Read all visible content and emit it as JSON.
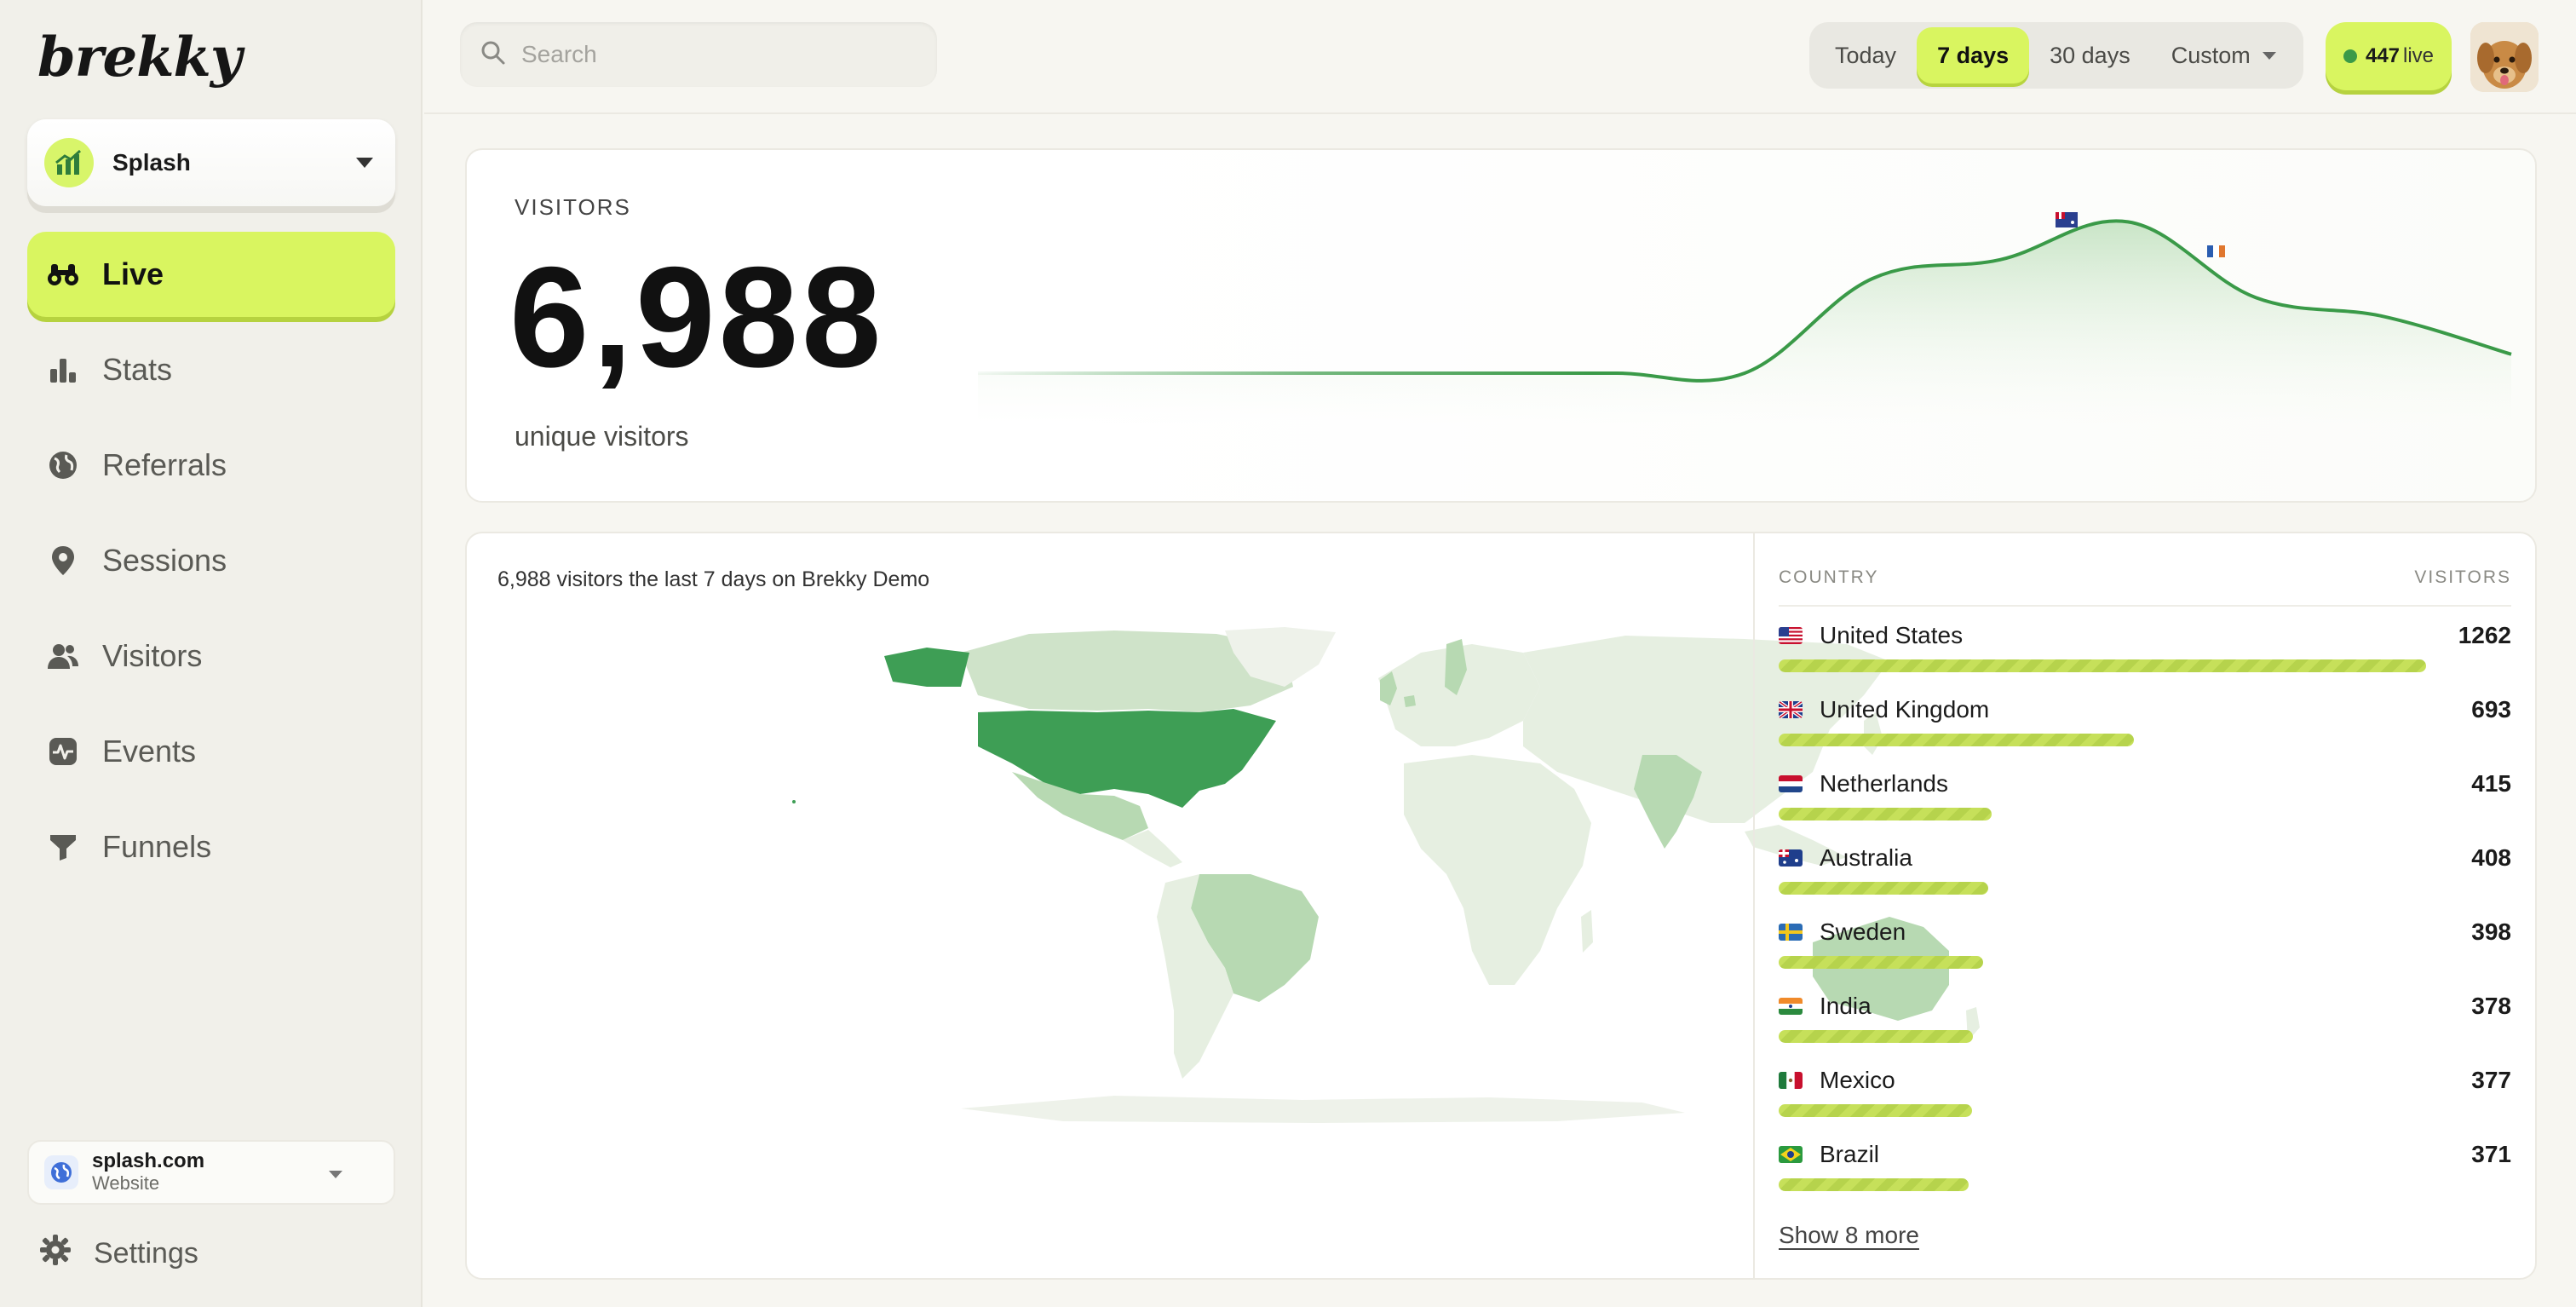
{
  "app": {
    "logo_text": "brekky"
  },
  "site_switcher": {
    "name": "Splash"
  },
  "nav": {
    "items": [
      {
        "label": "Live",
        "icon": "binoculars-icon",
        "active": true
      },
      {
        "label": "Stats",
        "icon": "bar-chart-icon"
      },
      {
        "label": "Referrals",
        "icon": "globe-icon"
      },
      {
        "label": "Sessions",
        "icon": "map-pin-icon"
      },
      {
        "label": "Visitors",
        "icon": "users-icon"
      },
      {
        "label": "Events",
        "icon": "activity-icon"
      },
      {
        "label": "Funnels",
        "icon": "funnel-icon"
      }
    ],
    "settings_label": "Settings"
  },
  "website_card": {
    "domain": "splash.com",
    "type": "Website"
  },
  "search": {
    "placeholder": "Search"
  },
  "date_range": {
    "options": [
      "Today",
      "7 days",
      "30 days",
      "Custom"
    ],
    "selected": "7 days"
  },
  "live": {
    "count": "447",
    "suffix": "live"
  },
  "visitors": {
    "label": "VISITORS",
    "total": "6,988",
    "subtitle": "unique visitors"
  },
  "chart_data": {
    "type": "area",
    "x": [
      0,
      1,
      2,
      3,
      4,
      5,
      6,
      7,
      8,
      9,
      10,
      11,
      12
    ],
    "values": [
      0,
      0,
      0,
      0,
      0,
      0,
      0,
      5,
      6,
      8,
      4,
      3,
      1
    ],
    "ylim": [
      0,
      10
    ],
    "grid": false
  },
  "map": {
    "title": "6,988 visitors the last 7 days on Brekky Demo",
    "colors": {
      "high": "#3e9e55",
      "medium": "#b7d9b2",
      "low": "#e6efe1",
      "none": "#f2f5ee"
    }
  },
  "countries": {
    "header_country": "COUNTRY",
    "header_visitors": "VISITORS",
    "max": 1262,
    "rows": [
      {
        "name": "United States",
        "visitors": 1262,
        "flag": "us"
      },
      {
        "name": "United Kingdom",
        "visitors": 693,
        "flag": "gb"
      },
      {
        "name": "Netherlands",
        "visitors": 415,
        "flag": "nl"
      },
      {
        "name": "Australia",
        "visitors": 408,
        "flag": "au"
      },
      {
        "name": "Sweden",
        "visitors": 398,
        "flag": "se"
      },
      {
        "name": "India",
        "visitors": 378,
        "flag": "in"
      },
      {
        "name": "Mexico",
        "visitors": 377,
        "flag": "mx"
      },
      {
        "name": "Brazil",
        "visitors": 371,
        "flag": "br"
      }
    ],
    "show_more": "Show 8 more"
  },
  "accent_colors": {
    "lime": "#d9f560",
    "green_line": "#3a9a48"
  }
}
